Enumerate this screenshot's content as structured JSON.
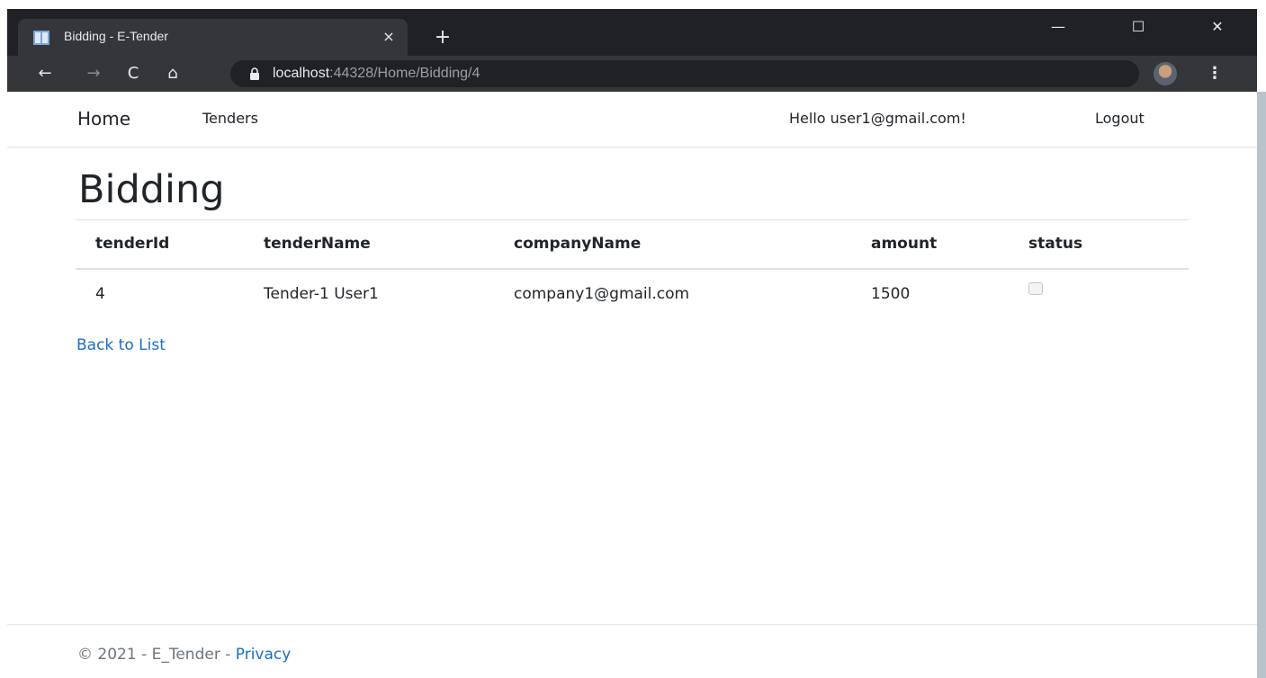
{
  "browser": {
    "tab_title": "Bidding - E-Tender",
    "tab_close": "×",
    "new_tab": "+",
    "url_host": "localhost",
    "url_path": ":44328/Home/Bidding/4",
    "window_min": "—",
    "window_max": "☐",
    "window_close": "✕",
    "back": "←",
    "forward": "→",
    "reload": "C",
    "home": "⌂",
    "star": "☆",
    "menu": "⋮"
  },
  "site_nav": {
    "brand": "Home",
    "tenders": "Tenders",
    "hello": "Hello user1@gmail.com!",
    "logout": "Logout"
  },
  "main": {
    "title": "Bidding",
    "columns": [
      "tenderId",
      "tenderName",
      "companyName",
      "amount",
      "status"
    ],
    "rows": [
      {
        "tenderId": "4",
        "tenderName": "Tender-1 User1",
        "companyName": "company1@gmail.com",
        "amount": "1500",
        "status": false
      }
    ],
    "back_link": "Back to List"
  },
  "footer": {
    "text": "© 2021 - E_Tender - ",
    "privacy": "Privacy"
  },
  "colors": {
    "chrome_dark": "#202124",
    "chrome_toolbar": "#35363a",
    "link": "#1b6ec2",
    "text": "#212529",
    "muted": "#6c757d"
  }
}
